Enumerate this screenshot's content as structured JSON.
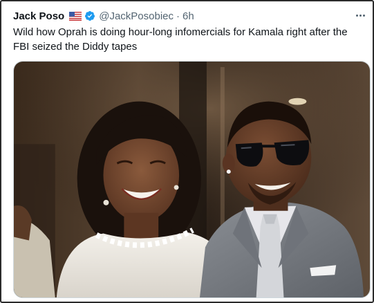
{
  "tweet": {
    "author": {
      "display_name": "Jack Poso",
      "flag_icon": "us-flag-icon",
      "verified_icon": "verified-badge-icon",
      "handle": "@JackPosobiec",
      "separator": "·",
      "time": "6h"
    },
    "more_icon": "more-options-icon",
    "text": "Wild how Oprah is doing hour-long infomercials for Kamala right after the FBI seized the Diddy tapes",
    "media": {
      "kind": "photo",
      "subjects": [
        "woman in white ruffled blouse smiling",
        "man in sunglasses and grey suit"
      ]
    }
  },
  "colors": {
    "text_primary": "#0f1419",
    "text_secondary": "#536471",
    "verified_blue": "#1d9bf0",
    "frame_border": "#2b2b2b"
  }
}
